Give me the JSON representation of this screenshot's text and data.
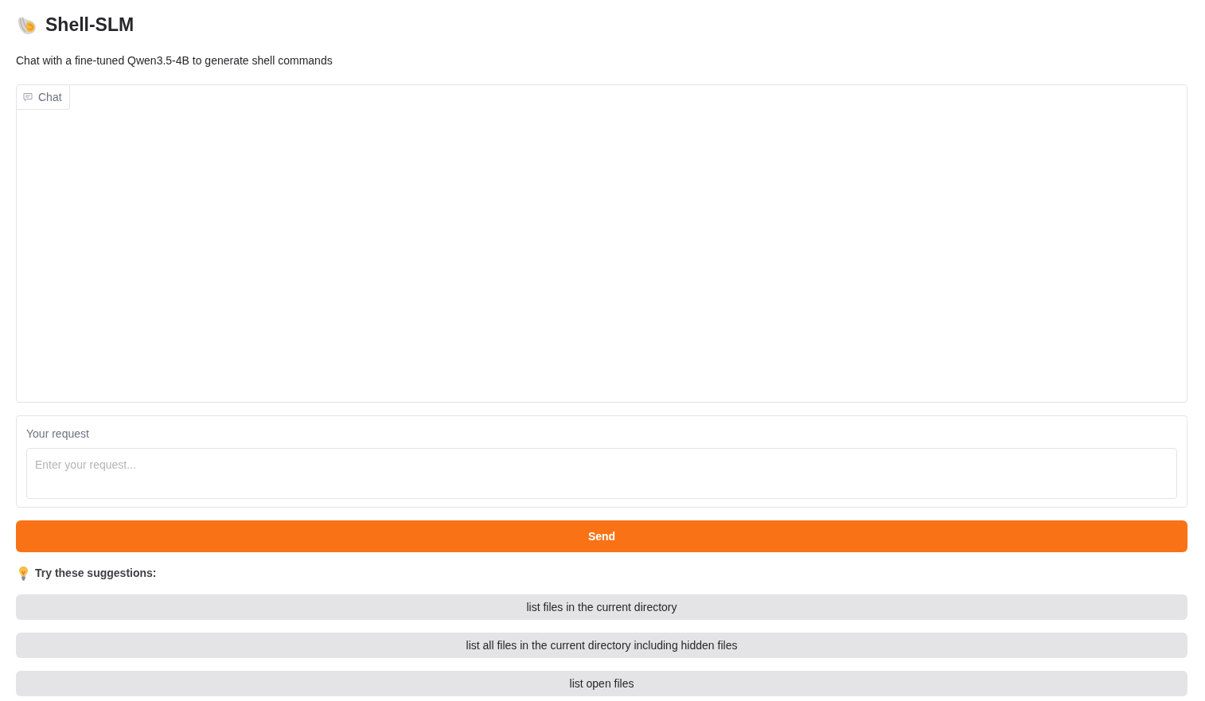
{
  "header": {
    "title": "Shell-SLM",
    "subtitle": "Chat with a fine-tuned Qwen3.5-4B to generate shell commands"
  },
  "chatbot": {
    "label": "Chat"
  },
  "request": {
    "label": "Your request",
    "placeholder": "Enter your request..."
  },
  "send_button": {
    "label": "Send"
  },
  "suggestions": {
    "heading": "Try these suggestions:",
    "items": [
      "list files in the current directory",
      "list all files in the current directory including hidden files",
      "list open files"
    ]
  }
}
